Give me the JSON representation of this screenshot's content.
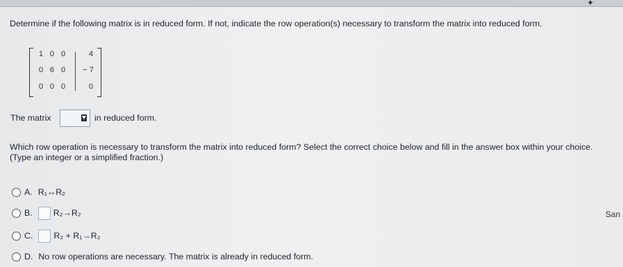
{
  "question": {
    "prompt": "Determine if the following matrix is in reduced form. If not, indicate the row operation(s) necessary to transform the matrix into reduced form."
  },
  "matrix": {
    "rows": [
      [
        "1",
        "0",
        "0",
        "4"
      ],
      [
        "0",
        "6",
        "0",
        "− 7"
      ],
      [
        "0",
        "0",
        "0",
        "0"
      ]
    ]
  },
  "statement": {
    "prefix": "The matrix",
    "suffix": "in reduced form."
  },
  "instructions": {
    "line1": "Which row operation is necessary to transform the matrix into reduced form? Select the correct choice below and fill in the answer box within your choice.",
    "line2": "(Type an integer or a simplified fraction.)"
  },
  "choices": [
    {
      "letter": "A.",
      "text": "R₁↔R₂"
    },
    {
      "letter": "B.",
      "text": "R₂→R₂"
    },
    {
      "letter": "C.",
      "text": "R₂ + R₁→R₂"
    },
    {
      "letter": "D.",
      "text": "No row operations are necessary. The matrix is already in reduced form."
    }
  ],
  "side": {
    "text": "San"
  }
}
